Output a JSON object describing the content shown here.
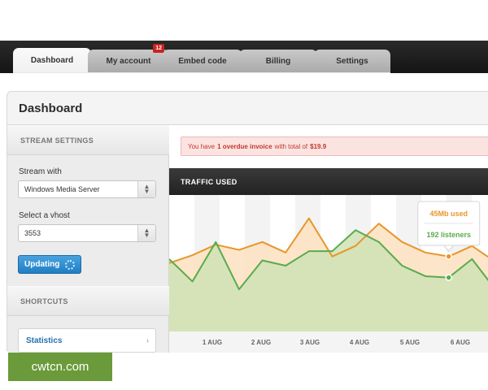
{
  "tabs": [
    {
      "label": "Dashboard",
      "active": true
    },
    {
      "label": "My account",
      "badge": "12"
    },
    {
      "label": "Embed code"
    },
    {
      "label": "Billing"
    },
    {
      "label": "Settings"
    }
  ],
  "page": {
    "title": "Dashboard"
  },
  "sidebar": {
    "stream_settings_title": "STREAM SETTINGS",
    "stream_with_label": "Stream with",
    "stream_with_value": "Windows Media Server",
    "vhost_label": "Select a vhost",
    "vhost_value": "3553",
    "updating_label": "Updating",
    "shortcuts_title": "SHORTCUTS",
    "shortcut_statistics": "Statistics"
  },
  "alert": {
    "prefix": "You have",
    "highlight1": "1 overdue invoice",
    "middle": "with total of",
    "amount": "$19.9"
  },
  "traffic": {
    "title": "TRAFFIC USED"
  },
  "tooltip": {
    "usage": "45Mb used",
    "listeners": "192 listeners"
  },
  "colors": {
    "orange": "#e8962a",
    "green": "#5aab4c",
    "alert_text": "#c0392b",
    "accent_blue": "#2c8fd6"
  },
  "chart_data": {
    "type": "area",
    "x_labels": [
      "1 AUG",
      "2 AUG",
      "3 AUG",
      "4 AUG",
      "5 AUG",
      "6 AUG"
    ],
    "series": [
      {
        "name": "used",
        "color": "#e8962a",
        "values": [
          0.52,
          0.58,
          0.66,
          0.62,
          0.68,
          0.6,
          0.86,
          0.57,
          0.65,
          0.82,
          0.68,
          0.6,
          0.57,
          0.65,
          0.53
        ]
      },
      {
        "name": "listeners",
        "color": "#5aab4c",
        "values": [
          0.55,
          0.38,
          0.68,
          0.32,
          0.54,
          0.5,
          0.61,
          0.61,
          0.77,
          0.68,
          0.5,
          0.42,
          0.41,
          0.55,
          0.32
        ]
      }
    ],
    "highlight_index": 12,
    "grid": true
  }
}
